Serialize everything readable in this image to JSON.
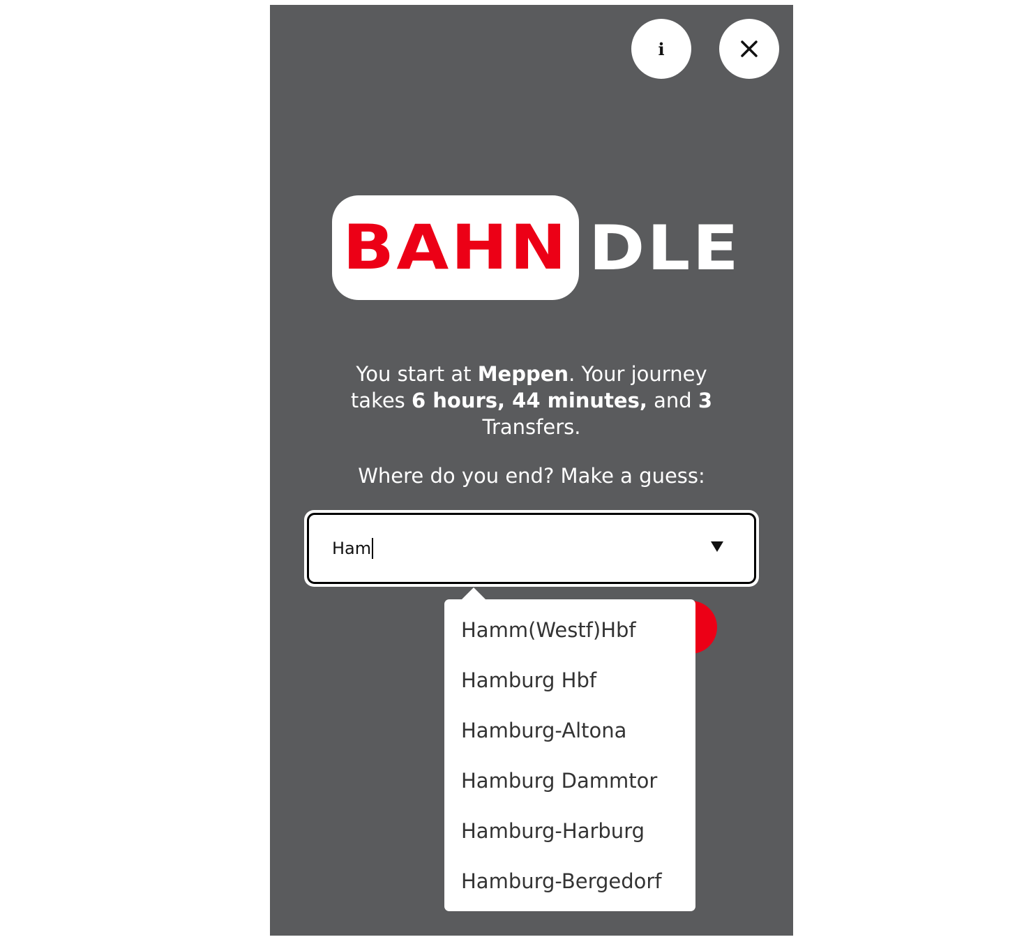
{
  "header": {
    "info_icon": "info-icon",
    "info_glyph": "i",
    "close_icon": "close-icon"
  },
  "logo": {
    "part1": "BAHN",
    "part2": "DLE",
    "brand_red": "#ec0016"
  },
  "intro": {
    "t1": "You start at ",
    "start_station": "Meppen",
    "t2": ". Your journey takes ",
    "duration": "6 hours, 44 minutes,",
    "t3": " and ",
    "transfers_count": "3",
    "t4": " Transfers."
  },
  "prompt": "Where do you end? Make a guess:",
  "search": {
    "value": "Ham",
    "arrow_icon": "triangle-down-icon"
  },
  "dropdown": {
    "options": [
      "Hamm(Westf)Hbf",
      "Hamburg Hbf",
      "Hamburg-Altona",
      "Hamburg Dammtor",
      "Hamburg-Harburg",
      "Hamburg-Bergedorf"
    ]
  },
  "colors": {
    "panel_bg": "#5a5b5d",
    "accent_red": "#ec0016"
  }
}
